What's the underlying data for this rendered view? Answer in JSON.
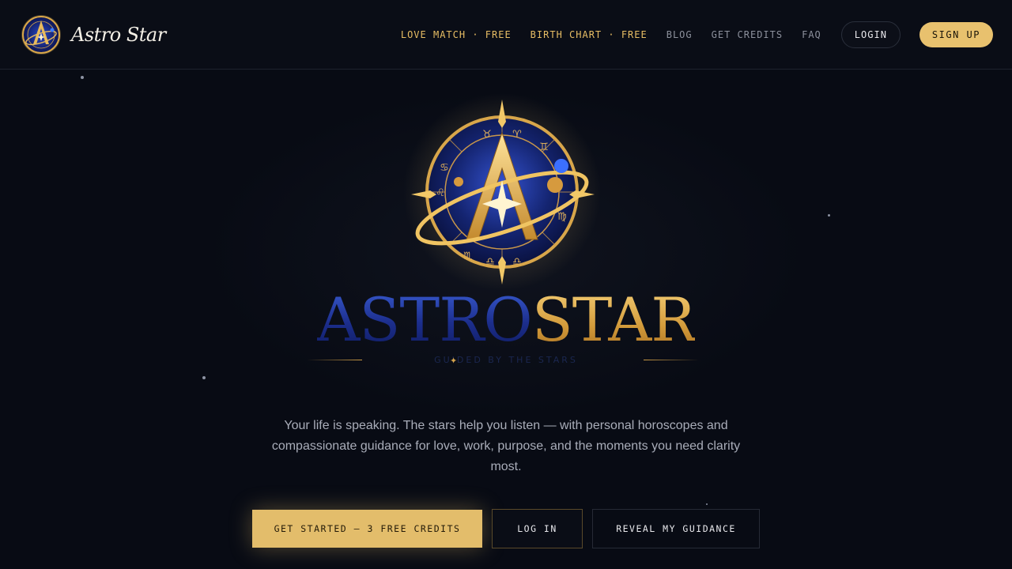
{
  "brand": {
    "name": "Astro Star",
    "logo_icon": "astro-star-emblem-icon"
  },
  "nav": {
    "love_match": "LOVE MATCH · FREE",
    "birth_chart": "BIRTH CHART · FREE",
    "blog": "BLOG",
    "get_credits": "GET CREDITS",
    "faq": "FAQ",
    "login": "LOGIN",
    "signup": "SIGN UP"
  },
  "hero": {
    "wordmark_astro": "ASTRO",
    "wordmark_star": "STAR",
    "tagline": "GUIDED BY THE STARS",
    "lead": "Your life is speaking. The stars help you listen — with personal horoscopes and compassionate guidance for love, work, purpose, and the moments you need clarity most."
  },
  "cta": {
    "primary": "GET STARTED — 3 FREE CREDITS",
    "login": "LOG IN",
    "reveal": "REVEAL MY GUIDANCE"
  },
  "colors": {
    "background": "#080b14",
    "gold": "#e7bd64",
    "button_gold": "#e8c16e",
    "muted": "#8c909c",
    "navy": "#1c2e8c"
  }
}
